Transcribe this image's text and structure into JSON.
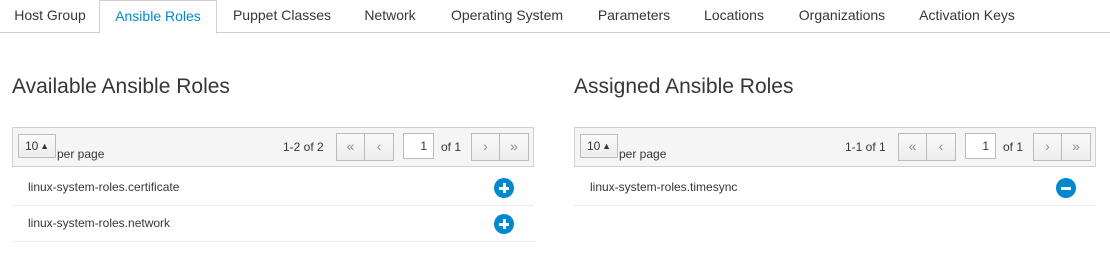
{
  "tabs": [
    {
      "label": "Host Group"
    },
    {
      "label": "Ansible Roles"
    },
    {
      "label": "Puppet Classes"
    },
    {
      "label": "Network"
    },
    {
      "label": "Operating System"
    },
    {
      "label": "Parameters"
    },
    {
      "label": "Locations"
    },
    {
      "label": "Organizations"
    },
    {
      "label": "Activation Keys"
    }
  ],
  "active_tab": "Ansible Roles",
  "colors": {
    "accent": "#0088ce",
    "text": "#363636",
    "toolbar_bg": "#f5f5f5"
  },
  "available": {
    "title": "Available Ansible Roles",
    "per_page_value": "10",
    "per_page_label": "per page",
    "range": "1-2 of 2",
    "first_icon": "«",
    "prev_icon": "‹",
    "page_value": "1",
    "of_pages": "of 1",
    "next_icon": "›",
    "last_icon": "»",
    "rows": [
      {
        "label": "linux-system-roles.certificate",
        "action_icon": "plus-circle-icon"
      },
      {
        "label": "linux-system-roles.network",
        "action_icon": "plus-circle-icon"
      }
    ]
  },
  "assigned": {
    "title": "Assigned Ansible Roles",
    "per_page_value": "10",
    "per_page_label": "per page",
    "range": "1-1 of 1",
    "first_icon": "«",
    "prev_icon": "‹",
    "page_value": "1",
    "of_pages": "of 1",
    "next_icon": "›",
    "last_icon": "»",
    "rows": [
      {
        "label": "linux-system-roles.timesync",
        "action_icon": "minus-circle-icon"
      }
    ]
  }
}
